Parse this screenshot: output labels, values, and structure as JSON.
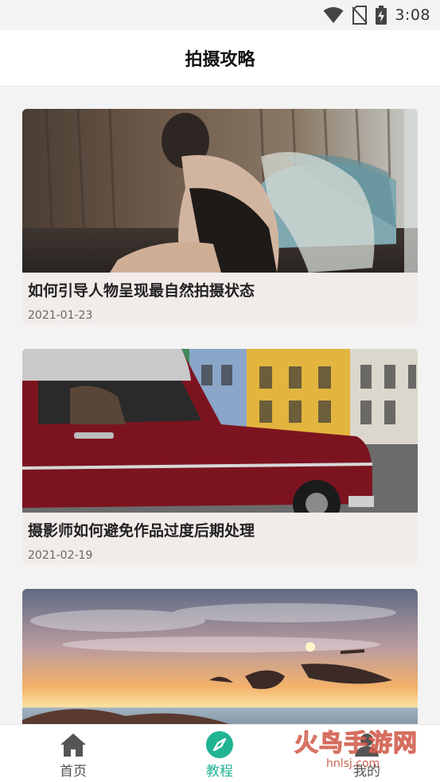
{
  "status_bar": {
    "time": "3:08",
    "icons": [
      "wifi-icon",
      "no-sim-icon",
      "battery-charging-icon"
    ]
  },
  "header": {
    "title": "拍摄攻略"
  },
  "articles": [
    {
      "title": "如何引导人物呈现最自然拍摄状态",
      "date": "2021-01-23",
      "image": "woman-in-black-lace-photo"
    },
    {
      "title": "摄影师如何避免作品过度后期处理",
      "date": "2021-02-19",
      "image": "red-classic-car-street-photo"
    },
    {
      "title": "",
      "date": "",
      "image": "sunset-over-sea-photo"
    }
  ],
  "tabbar": {
    "active": "教程",
    "tabs": [
      {
        "label": "首页",
        "icon": "home-icon"
      },
      {
        "label": "教程",
        "icon": "compass-icon"
      },
      {
        "label": "我的",
        "icon": "profile-icon"
      }
    ]
  },
  "watermark": {
    "text": "火鸟手游网",
    "url": "hnlsj.com"
  },
  "colors": {
    "accent": "#20b493",
    "card_background": "#f1ecea",
    "page_background": "#f3f3f3"
  }
}
